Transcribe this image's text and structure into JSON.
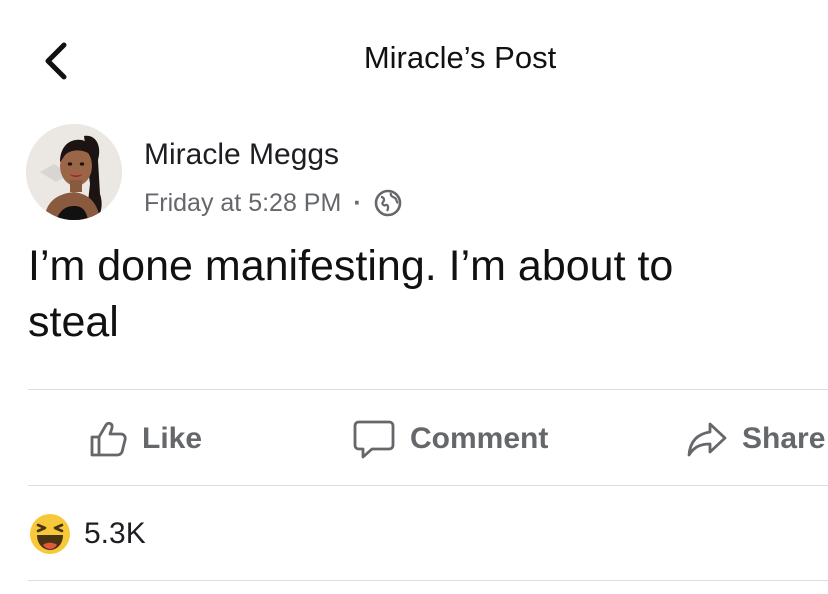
{
  "header": {
    "title": "Miracle’s Post"
  },
  "post": {
    "author": "Miracle Meggs",
    "timestamp": "Friday at 5:28 PM",
    "separator": "·",
    "privacy_icon": "globe-icon",
    "text_lines": [
      "I’m done manifesting. I’m about to",
      "steal"
    ]
  },
  "actions": {
    "like_label": "Like",
    "comment_label": "Comment",
    "share_label": "Share"
  },
  "reactions": {
    "icon": "haha-reaction-icon",
    "count": "5.3K"
  },
  "colors": {
    "text": "#1c1e21",
    "secondary": "#65676b",
    "divider": "#dadde1",
    "reaction_yellow": "#f7c93a"
  }
}
